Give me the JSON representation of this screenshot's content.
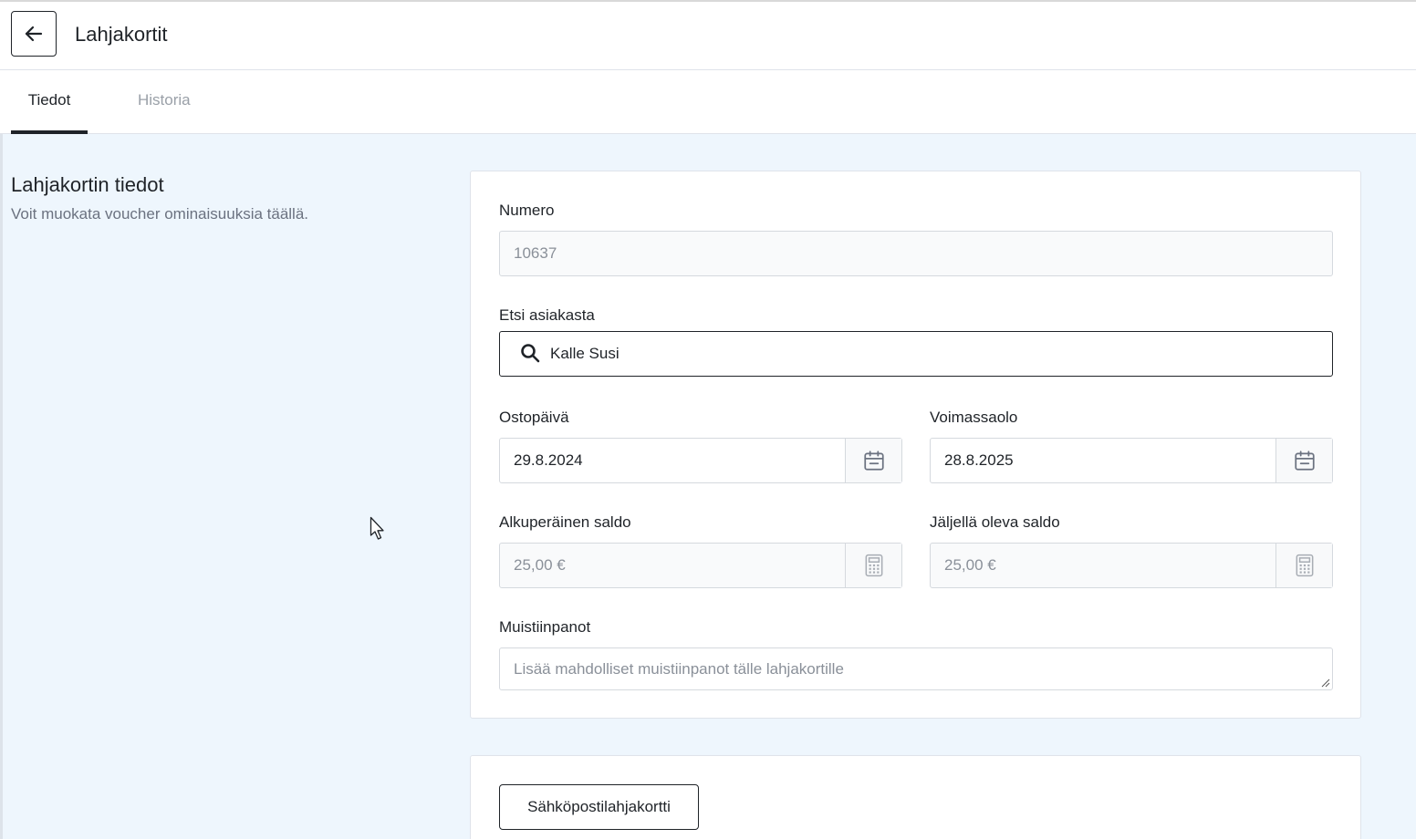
{
  "header": {
    "title": "Lahjakortit",
    "back_icon": "arrow-left-icon"
  },
  "tabs": [
    {
      "label": "Tiedot",
      "active": true
    },
    {
      "label": "Historia",
      "active": false
    }
  ],
  "section": {
    "title": "Lahjakortin tiedot",
    "description": "Voit muokata voucher ominaisuuksia täällä."
  },
  "form": {
    "number": {
      "label": "Numero",
      "value": "10637",
      "disabled": true
    },
    "customer": {
      "label": "Etsi asiakasta",
      "value": "Kalle Susi",
      "icon": "search-icon"
    },
    "purchase_date": {
      "label": "Ostopäivä",
      "value": "29.8.2024",
      "icon": "calendar-icon"
    },
    "valid_until": {
      "label": "Voimassaolo",
      "value": "28.8.2025",
      "icon": "calendar-icon"
    },
    "original_balance": {
      "label": "Alkuperäinen saldo",
      "value": "25,00 €",
      "icon": "calculator-icon",
      "disabled": true
    },
    "remaining_balance": {
      "label": "Jäljellä oleva saldo",
      "value": "25,00 €",
      "icon": "calculator-icon",
      "disabled": true
    },
    "notes": {
      "label": "Muistiinpanot",
      "placeholder": "Lisää mahdolliset muistiinpanot tälle lahjakortille"
    }
  },
  "actions": {
    "email_giftcard": "Sähköpostilahjakortti"
  },
  "colors": {
    "text": "#1f2328",
    "muted": "#6b7280",
    "background": "#eef6fd",
    "border": "#d5d9de"
  }
}
